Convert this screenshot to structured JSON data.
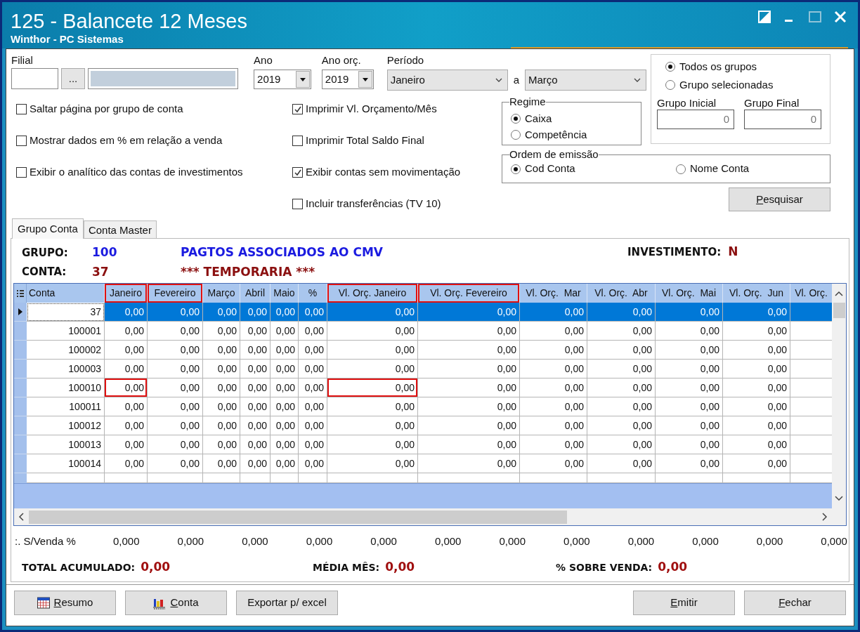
{
  "window": {
    "title": "125 - Balancete 12 Meses",
    "subtitle": "Winthor - PC Sistemas"
  },
  "filters": {
    "filial": {
      "label": "Filial",
      "button": "..."
    },
    "ano": {
      "label": "Ano",
      "value": "2019"
    },
    "ano_orc": {
      "label": "Ano orç.",
      "value": "2019"
    },
    "periodo": {
      "label": "Período",
      "from": "Janeiro",
      "separator": "a",
      "to": "Março"
    }
  },
  "options_left": [
    {
      "label": "Saltar página por grupo de conta",
      "checked": false
    },
    {
      "label": "Mostrar dados em % em relação a venda",
      "checked": false
    },
    {
      "label": "Exibir o analítico das contas de investimentos",
      "checked": false
    }
  ],
  "options_right": [
    {
      "label": "Imprimir Vl. Orçamento/Mês",
      "checked": true
    },
    {
      "label": "Imprimir Total Saldo Final",
      "checked": false
    },
    {
      "label": "Exibir contas sem movimentação",
      "checked": true
    },
    {
      "label": "Incluir transferências (TV 10)",
      "checked": false
    }
  ],
  "regime": {
    "title": "Regime",
    "options": [
      {
        "label": "Caixa",
        "selected": true
      },
      {
        "label": "Competência",
        "selected": false
      }
    ]
  },
  "grupos": {
    "options": [
      {
        "label": "Todos os grupos",
        "selected": true
      },
      {
        "label": "Grupo selecionadas",
        "selected": false
      }
    ],
    "inicial": {
      "label": "Grupo Inicial",
      "value": "0"
    },
    "final": {
      "label": "Grupo Final",
      "value": "0"
    }
  },
  "ordem": {
    "title": "Ordem de emissão",
    "options": [
      {
        "label": "Cod Conta",
        "selected": true
      },
      {
        "label": "Nome Conta",
        "selected": false
      }
    ]
  },
  "search_button": {
    "label": "Pesquisar",
    "underline_first": true
  },
  "tabs": [
    {
      "label": "Grupo Conta",
      "selected": true
    },
    {
      "label": "Conta Master",
      "selected": false
    }
  ],
  "info": {
    "grupo_label": "GRUPO:",
    "grupo_value": "100",
    "grupo_name": "PAGTOS ASSOCIADOS AO CMV",
    "conta_label": "CONTA:",
    "conta_value": "37",
    "conta_name": "*** TEMPORARIA ***",
    "investimento_label": "INVESTIMENTO:",
    "investimento_value": "N"
  },
  "grid": {
    "columns": [
      {
        "label": "Conta",
        "highlighted": false
      },
      {
        "label": "Janeiro",
        "highlighted": true
      },
      {
        "label": "Fevereiro",
        "highlighted": true
      },
      {
        "label": "Março",
        "highlighted": false
      },
      {
        "label": "Abril",
        "highlighted": false
      },
      {
        "label": "Maio",
        "highlighted": false
      },
      {
        "label": "%",
        "highlighted": false
      },
      {
        "label": "Vl. Orç. Janeiro",
        "highlighted": true
      },
      {
        "label": "Vl. Orç. Fevereiro",
        "highlighted": true
      },
      {
        "label": "Vl. Orç.  Mar",
        "highlighted": false
      },
      {
        "label": "Vl. Orç.  Abr",
        "highlighted": false
      },
      {
        "label": "Vl. Orç.  Mai",
        "highlighted": false
      },
      {
        "label": "Vl. Orç.  Jun",
        "highlighted": false
      },
      {
        "label": "Vl. Orç.",
        "highlighted": false
      }
    ],
    "rows": [
      {
        "selected": true,
        "cells": [
          {
            "text": "37",
            "highlighted": false
          },
          {
            "text": "0,00",
            "highlighted": false
          },
          {
            "text": "0,00",
            "highlighted": false
          },
          {
            "text": "0,00",
            "highlighted": false
          },
          {
            "text": "0,00",
            "highlighted": false
          },
          {
            "text": "0,00",
            "highlighted": false
          },
          {
            "text": "0,00",
            "highlighted": false
          },
          {
            "text": "0,00",
            "highlighted": false
          },
          {
            "text": "0,00",
            "highlighted": false
          },
          {
            "text": "0,00",
            "highlighted": false
          },
          {
            "text": "0,00",
            "highlighted": false
          },
          {
            "text": "0,00",
            "highlighted": false
          },
          {
            "text": "0,00",
            "highlighted": false
          }
        ]
      },
      {
        "selected": false,
        "cells": [
          {
            "text": "100001",
            "highlighted": false
          },
          {
            "text": "0,00",
            "highlighted": false
          },
          {
            "text": "0,00",
            "highlighted": false
          },
          {
            "text": "0,00",
            "highlighted": false
          },
          {
            "text": "0,00",
            "highlighted": false
          },
          {
            "text": "0,00",
            "highlighted": false
          },
          {
            "text": "0,00",
            "highlighted": false
          },
          {
            "text": "0,00",
            "highlighted": false
          },
          {
            "text": "0,00",
            "highlighted": false
          },
          {
            "text": "0,00",
            "highlighted": false
          },
          {
            "text": "0,00",
            "highlighted": false
          },
          {
            "text": "0,00",
            "highlighted": false
          },
          {
            "text": "0,00",
            "highlighted": false
          }
        ]
      },
      {
        "selected": false,
        "cells": [
          {
            "text": "100002",
            "highlighted": false
          },
          {
            "text": "0,00",
            "highlighted": false
          },
          {
            "text": "0,00",
            "highlighted": false
          },
          {
            "text": "0,00",
            "highlighted": false
          },
          {
            "text": "0,00",
            "highlighted": false
          },
          {
            "text": "0,00",
            "highlighted": false
          },
          {
            "text": "0,00",
            "highlighted": false
          },
          {
            "text": "0,00",
            "highlighted": false
          },
          {
            "text": "0,00",
            "highlighted": false
          },
          {
            "text": "0,00",
            "highlighted": false
          },
          {
            "text": "0,00",
            "highlighted": false
          },
          {
            "text": "0,00",
            "highlighted": false
          },
          {
            "text": "0,00",
            "highlighted": false
          }
        ]
      },
      {
        "selected": false,
        "cells": [
          {
            "text": "100003",
            "highlighted": false
          },
          {
            "text": "0,00",
            "highlighted": false
          },
          {
            "text": "0,00",
            "highlighted": false
          },
          {
            "text": "0,00",
            "highlighted": false
          },
          {
            "text": "0,00",
            "highlighted": false
          },
          {
            "text": "0,00",
            "highlighted": false
          },
          {
            "text": "0,00",
            "highlighted": false
          },
          {
            "text": "0,00",
            "highlighted": false
          },
          {
            "text": "0,00",
            "highlighted": false
          },
          {
            "text": "0,00",
            "highlighted": false
          },
          {
            "text": "0,00",
            "highlighted": false
          },
          {
            "text": "0,00",
            "highlighted": false
          },
          {
            "text": "0,00",
            "highlighted": false
          }
        ]
      },
      {
        "selected": false,
        "cells": [
          {
            "text": "100010",
            "highlighted": false
          },
          {
            "text": "0,00",
            "highlighted": true
          },
          {
            "text": "0,00",
            "highlighted": false
          },
          {
            "text": "0,00",
            "highlighted": false
          },
          {
            "text": "0,00",
            "highlighted": false
          },
          {
            "text": "0,00",
            "highlighted": false
          },
          {
            "text": "0,00",
            "highlighted": false
          },
          {
            "text": "0,00",
            "highlighted": true
          },
          {
            "text": "0,00",
            "highlighted": false
          },
          {
            "text": "0,00",
            "highlighted": false
          },
          {
            "text": "0,00",
            "highlighted": false
          },
          {
            "text": "0,00",
            "highlighted": false
          },
          {
            "text": "0,00",
            "highlighted": false
          }
        ]
      },
      {
        "selected": false,
        "cells": [
          {
            "text": "100011",
            "highlighted": false
          },
          {
            "text": "0,00",
            "highlighted": false
          },
          {
            "text": "0,00",
            "highlighted": false
          },
          {
            "text": "0,00",
            "highlighted": false
          },
          {
            "text": "0,00",
            "highlighted": false
          },
          {
            "text": "0,00",
            "highlighted": false
          },
          {
            "text": "0,00",
            "highlighted": false
          },
          {
            "text": "0,00",
            "highlighted": false
          },
          {
            "text": "0,00",
            "highlighted": false
          },
          {
            "text": "0,00",
            "highlighted": false
          },
          {
            "text": "0,00",
            "highlighted": false
          },
          {
            "text": "0,00",
            "highlighted": false
          },
          {
            "text": "0,00",
            "highlighted": false
          }
        ]
      },
      {
        "selected": false,
        "cells": [
          {
            "text": "100012",
            "highlighted": false
          },
          {
            "text": "0,00",
            "highlighted": false
          },
          {
            "text": "0,00",
            "highlighted": false
          },
          {
            "text": "0,00",
            "highlighted": false
          },
          {
            "text": "0,00",
            "highlighted": false
          },
          {
            "text": "0,00",
            "highlighted": false
          },
          {
            "text": "0,00",
            "highlighted": false
          },
          {
            "text": "0,00",
            "highlighted": false
          },
          {
            "text": "0,00",
            "highlighted": false
          },
          {
            "text": "0,00",
            "highlighted": false
          },
          {
            "text": "0,00",
            "highlighted": false
          },
          {
            "text": "0,00",
            "highlighted": false
          },
          {
            "text": "0,00",
            "highlighted": false
          }
        ]
      },
      {
        "selected": false,
        "cells": [
          {
            "text": "100013",
            "highlighted": false
          },
          {
            "text": "0,00",
            "highlighted": false
          },
          {
            "text": "0,00",
            "highlighted": false
          },
          {
            "text": "0,00",
            "highlighted": false
          },
          {
            "text": "0,00",
            "highlighted": false
          },
          {
            "text": "0,00",
            "highlighted": false
          },
          {
            "text": "0,00",
            "highlighted": false
          },
          {
            "text": "0,00",
            "highlighted": false
          },
          {
            "text": "0,00",
            "highlighted": false
          },
          {
            "text": "0,00",
            "highlighted": false
          },
          {
            "text": "0,00",
            "highlighted": false
          },
          {
            "text": "0,00",
            "highlighted": false
          },
          {
            "text": "0,00",
            "highlighted": false
          }
        ]
      },
      {
        "selected": false,
        "cells": [
          {
            "text": "100014",
            "highlighted": false
          },
          {
            "text": "0,00",
            "highlighted": false
          },
          {
            "text": "0,00",
            "highlighted": false
          },
          {
            "text": "0,00",
            "highlighted": false
          },
          {
            "text": "0,00",
            "highlighted": false
          },
          {
            "text": "0,00",
            "highlighted": false
          },
          {
            "text": "0,00",
            "highlighted": false
          },
          {
            "text": "0,00",
            "highlighted": false
          },
          {
            "text": "0,00",
            "highlighted": false
          },
          {
            "text": "0,00",
            "highlighted": false
          },
          {
            "text": "0,00",
            "highlighted": false
          },
          {
            "text": "0,00",
            "highlighted": false
          },
          {
            "text": "0,00",
            "highlighted": false
          }
        ]
      }
    ]
  },
  "footer": {
    "label": ":. S/Venda %",
    "values": [
      "0,000",
      "0,000",
      "0,000",
      "0,000",
      "0,000",
      "0,000",
      "0,000",
      "0,000",
      "0,000",
      "0,000",
      "0,000",
      "0,000"
    ]
  },
  "totals": [
    {
      "label": "TOTAL ACUMULADO:",
      "value": "0,00"
    },
    {
      "label": "MÉDIA MÊS:",
      "value": "0,00"
    },
    {
      "label": "% SOBRE VENDA:",
      "value": "0,00"
    }
  ],
  "buttons": [
    {
      "label": "Resumo",
      "underline_first": true
    },
    {
      "label": "Conta",
      "underline_first": true
    },
    {
      "label": "Exportar p/ excel",
      "underline_first": false
    },
    {
      "label": "Emitir",
      "underline_first": true
    },
    {
      "label": "Fechar",
      "underline_first": true
    }
  ]
}
